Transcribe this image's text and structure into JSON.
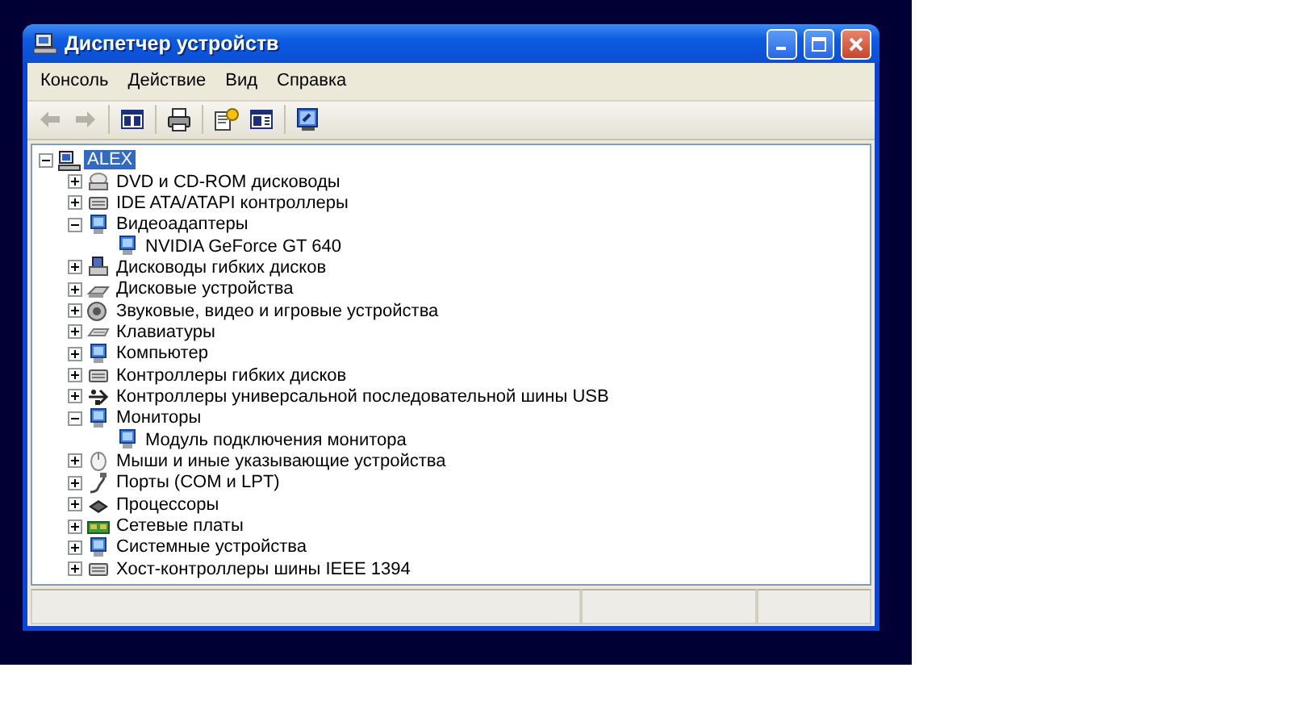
{
  "window": {
    "title": "Диспетчер устройств"
  },
  "menu": [
    "Консоль",
    "Действие",
    "Вид",
    "Справка"
  ],
  "toolbar": {
    "groups": [
      [
        {
          "kind": "back",
          "disabled": true
        },
        {
          "kind": "forward",
          "disabled": true
        }
      ],
      [
        {
          "kind": "tree",
          "disabled": false
        }
      ],
      [
        {
          "kind": "print",
          "disabled": false
        }
      ],
      [
        {
          "kind": "properties",
          "disabled": false
        },
        {
          "kind": "view",
          "disabled": false
        }
      ],
      [
        {
          "kind": "scan",
          "disabled": false
        }
      ]
    ]
  },
  "tree": {
    "label": "ALEX",
    "kind": "computer",
    "expanded": true,
    "selected": true,
    "children": [
      {
        "label": "DVD и CD-ROM дисководы",
        "kind": "disc",
        "expanded": false,
        "selected": false
      },
      {
        "label": "IDE ATA/ATAPI контроллеры",
        "kind": "controller",
        "expanded": false,
        "selected": false
      },
      {
        "label": "Видеоадаптеры",
        "kind": "display",
        "expanded": true,
        "selected": false,
        "children": [
          {
            "label": "NVIDIA GeForce GT 640",
            "kind": "display",
            "selected": false
          }
        ]
      },
      {
        "label": "Дисководы гибких дисков",
        "kind": "floppy",
        "expanded": false,
        "selected": false
      },
      {
        "label": "Дисковые устройства",
        "kind": "disk",
        "expanded": false,
        "selected": false
      },
      {
        "label": "Звуковые, видео и игровые устройства",
        "kind": "sound",
        "expanded": false,
        "selected": false
      },
      {
        "label": "Клавиатуры",
        "kind": "keyboard",
        "expanded": false,
        "selected": false
      },
      {
        "label": "Компьютер",
        "kind": "display",
        "expanded": false,
        "selected": false
      },
      {
        "label": "Контроллеры гибких дисков",
        "kind": "controller",
        "expanded": false,
        "selected": false
      },
      {
        "label": "Контроллеры универсальной последовательной шины USB",
        "kind": "usb",
        "expanded": false,
        "selected": false
      },
      {
        "label": "Мониторы",
        "kind": "display",
        "expanded": true,
        "selected": false,
        "children": [
          {
            "label": "Модуль подключения монитора",
            "kind": "display",
            "selected": false
          }
        ]
      },
      {
        "label": "Мыши и иные указывающие устройства",
        "kind": "mouse",
        "expanded": false,
        "selected": false
      },
      {
        "label": "Порты (COM и LPT)",
        "kind": "port",
        "expanded": false,
        "selected": false
      },
      {
        "label": "Процессоры",
        "kind": "cpu",
        "expanded": false,
        "selected": false
      },
      {
        "label": "Сетевые платы",
        "kind": "network",
        "expanded": false,
        "selected": false
      },
      {
        "label": "Системные устройства",
        "kind": "display",
        "expanded": false,
        "selected": false
      },
      {
        "label": "Хост-контроллеры шины IEEE 1394",
        "kind": "controller",
        "expanded": false,
        "selected": false
      }
    ]
  }
}
